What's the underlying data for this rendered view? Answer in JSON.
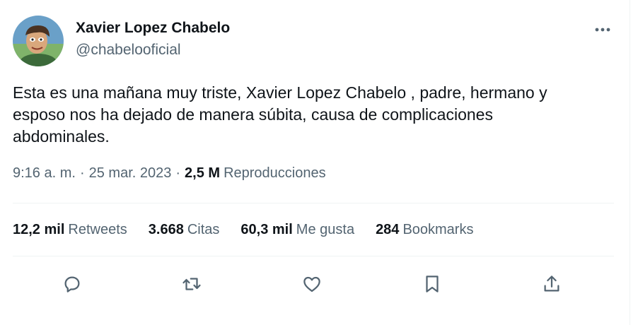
{
  "author": {
    "name": "Xavier Lopez Chabelo",
    "handle": "@chabelooficial",
    "avatar_icon": "avatar-photo"
  },
  "more_icon": "more-horizontal-icon",
  "tweet": {
    "text": "Esta es una mañana muy triste,  Xavier Lopez Chabelo , padre, hermano y esposo nos ha dejado de manera súbita, causa de complicaciones abdominales."
  },
  "meta": {
    "time": "9:16 a. m.",
    "separator": "·",
    "date": "25 mar. 2023",
    "views_count": "2,5 M",
    "views_label": "Reproducciones"
  },
  "stats": {
    "retweets": {
      "count": "12,2 mil",
      "label": "Retweets"
    },
    "quotes": {
      "count": "3.668",
      "label": "Citas"
    },
    "likes": {
      "count": "60,3 mil",
      "label": "Me gusta"
    },
    "bookmarks": {
      "count": "284",
      "label": "Bookmarks"
    }
  },
  "actions": {
    "reply": "reply-icon",
    "retweet": "retweet-icon",
    "like": "like-icon",
    "bookmark": "bookmark-icon",
    "share": "share-icon"
  },
  "colors": {
    "text_primary": "#0f1419",
    "text_secondary": "#536471",
    "divider": "#eff3f4"
  }
}
